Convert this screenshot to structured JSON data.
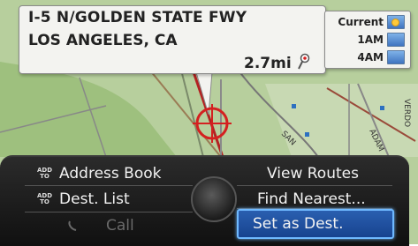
{
  "location": {
    "road": "I-5 N/GOLDEN STATE FWY",
    "city": "LOS ANGELES, CA",
    "distance": "2.7mi"
  },
  "weather": {
    "rows": [
      {
        "label": "Current",
        "icon": "sunny-icon"
      },
      {
        "label": "1AM",
        "icon": "clear-sky-icon"
      },
      {
        "label": "4AM",
        "icon": "clear-sky-icon"
      }
    ]
  },
  "map": {
    "street_labels": [
      "SAN",
      "ADAM",
      "VERDO"
    ]
  },
  "menu": {
    "address_book": "Address Book",
    "dest_list": "Dest. List",
    "call": "Call",
    "view_routes": "View Routes",
    "find_nearest": "Find Nearest...",
    "set_as_dest": "Set as Dest.",
    "add_to_top": "ADD",
    "add_to_bottom": "TO"
  },
  "colors": {
    "selection": "#2a5fb0",
    "map_green": "#b7cf9d",
    "road_red": "#b32222"
  }
}
